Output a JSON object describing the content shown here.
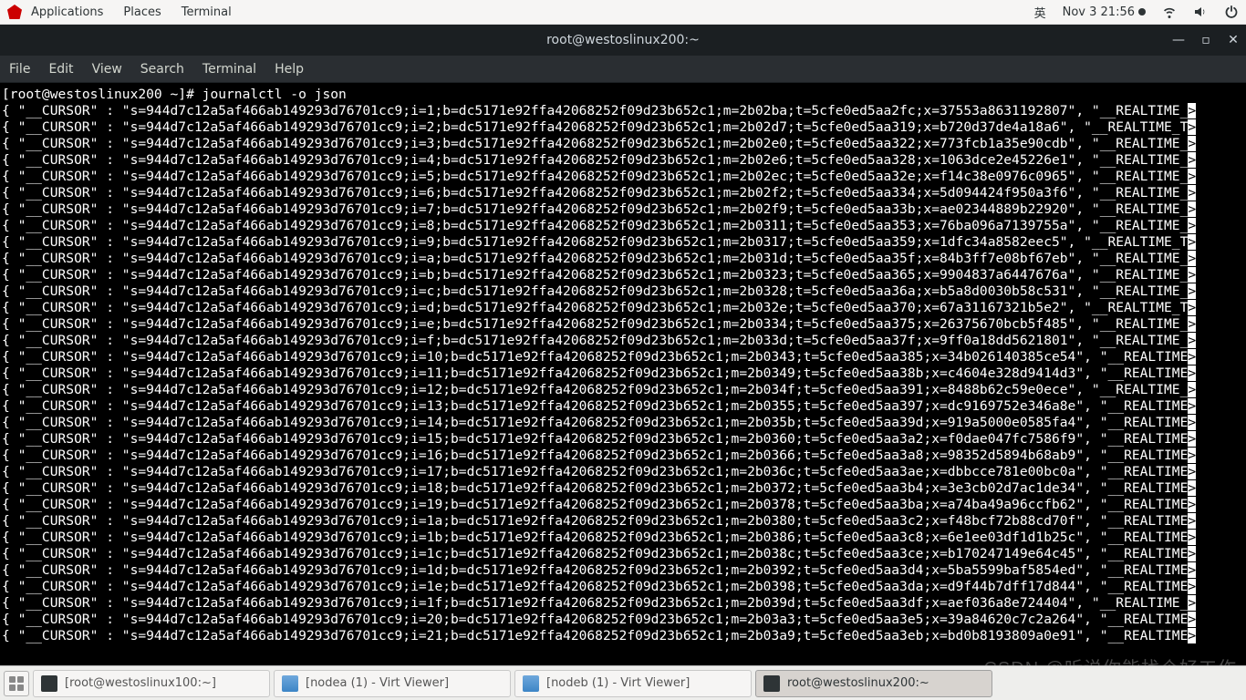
{
  "topbar": {
    "menus": [
      "Applications",
      "Places",
      "Terminal"
    ],
    "ime": "英",
    "clock": "Nov 3  21:56"
  },
  "terminal": {
    "title": "root@westoslinux200:~",
    "menus": [
      "File",
      "Edit",
      "View",
      "Search",
      "Terminal",
      "Help"
    ],
    "win_controls": {
      "min": "—",
      "max": "▫",
      "close": "✕"
    },
    "prompt": "[root@westoslinux200 ~]# ",
    "command": "journalctl -o json",
    "cursor_prefix": "{ \"__CURSOR\" : \"s=944d7c12a5af466ab149293d76701cc9;",
    "boot_id": ";b=dc5171e92ffa42068252f09d23b652c1;",
    "tail_key_a": "\", \"__REALTIME_T",
    "tail_key_b": "\", \"__REALTIME_TI",
    "tail_key_c": "\", \"__REALTIME_",
    "rows": [
      {
        "i": "i=1",
        "m": "m=2b02ba",
        "t": "t=5cfe0ed5aa2fc",
        "x": "x=37553a8631192807",
        "tail": "a"
      },
      {
        "i": "i=2",
        "m": "m=2b02d7",
        "t": "t=5cfe0ed5aa319",
        "x": "x=b720d37de4a18a6",
        "tail": "b"
      },
      {
        "i": "i=3",
        "m": "m=2b02e0",
        "t": "t=5cfe0ed5aa322",
        "x": "x=773fcb1a35e90cdb",
        "tail": "a"
      },
      {
        "i": "i=4",
        "m": "m=2b02e6",
        "t": "t=5cfe0ed5aa328",
        "x": "x=1063dce2e45226e1",
        "tail": "a"
      },
      {
        "i": "i=5",
        "m": "m=2b02ec",
        "t": "t=5cfe0ed5aa32e",
        "x": "x=f14c38e0976c0965",
        "tail": "a"
      },
      {
        "i": "i=6",
        "m": "m=2b02f2",
        "t": "t=5cfe0ed5aa334",
        "x": "x=5d094424f950a3f6",
        "tail": "a"
      },
      {
        "i": "i=7",
        "m": "m=2b02f9",
        "t": "t=5cfe0ed5aa33b",
        "x": "x=ae02344889b22920",
        "tail": "a"
      },
      {
        "i": "i=8",
        "m": "m=2b0311",
        "t": "t=5cfe0ed5aa353",
        "x": "x=76ba096a7139755a",
        "tail": "a"
      },
      {
        "i": "i=9",
        "m": "m=2b0317",
        "t": "t=5cfe0ed5aa359",
        "x": "x=1dfc34a8582eec5",
        "tail": "b"
      },
      {
        "i": "i=a",
        "m": "m=2b031d",
        "t": "t=5cfe0ed5aa35f",
        "x": "x=84b3ff7e08bf67eb",
        "tail": "a"
      },
      {
        "i": "i=b",
        "m": "m=2b0323",
        "t": "t=5cfe0ed5aa365",
        "x": "x=9904837a6447676a",
        "tail": "a"
      },
      {
        "i": "i=c",
        "m": "m=2b0328",
        "t": "t=5cfe0ed5aa36a",
        "x": "x=b5a8d0030b58c531",
        "tail": "a"
      },
      {
        "i": "i=d",
        "m": "m=2b032e",
        "t": "t=5cfe0ed5aa370",
        "x": "x=67a31167321b5e2",
        "tail": "b"
      },
      {
        "i": "i=e",
        "m": "m=2b0334",
        "t": "t=5cfe0ed5aa375",
        "x": "x=26375670bcb5f485",
        "tail": "a"
      },
      {
        "i": "i=f",
        "m": "m=2b033d",
        "t": "t=5cfe0ed5aa37f",
        "x": "x=9ff0a18dd5621801",
        "tail": "a"
      },
      {
        "i": "i=10",
        "m": "m=2b0343",
        "t": "t=5cfe0ed5aa385",
        "x": "x=34b026140385ce54",
        "tail": "c"
      },
      {
        "i": "i=11",
        "m": "m=2b0349",
        "t": "t=5cfe0ed5aa38b",
        "x": "x=c4604e328d9414d3",
        "tail": "c"
      },
      {
        "i": "i=12",
        "m": "m=2b034f",
        "t": "t=5cfe0ed5aa391",
        "x": "x=8488b62c59e0ece",
        "tail": "a"
      },
      {
        "i": "i=13",
        "m": "m=2b0355",
        "t": "t=5cfe0ed5aa397",
        "x": "x=dc9169752e346a8e",
        "tail": "c"
      },
      {
        "i": "i=14",
        "m": "m=2b035b",
        "t": "t=5cfe0ed5aa39d",
        "x": "x=919a5000e0585fa4",
        "tail": "c"
      },
      {
        "i": "i=15",
        "m": "m=2b0360",
        "t": "t=5cfe0ed5aa3a2",
        "x": "x=f0dae047fc7586f9",
        "tail": "c"
      },
      {
        "i": "i=16",
        "m": "m=2b0366",
        "t": "t=5cfe0ed5aa3a8",
        "x": "x=98352d5894b68ab9",
        "tail": "c"
      },
      {
        "i": "i=17",
        "m": "m=2b036c",
        "t": "t=5cfe0ed5aa3ae",
        "x": "x=dbbcce781e00bc0a",
        "tail": "c"
      },
      {
        "i": "i=18",
        "m": "m=2b0372",
        "t": "t=5cfe0ed5aa3b4",
        "x": "x=3e3cb02d7ac1de34",
        "tail": "c"
      },
      {
        "i": "i=19",
        "m": "m=2b0378",
        "t": "t=5cfe0ed5aa3ba",
        "x": "x=a74ba49a96ccfb62",
        "tail": "c"
      },
      {
        "i": "i=1a",
        "m": "m=2b0380",
        "t": "t=5cfe0ed5aa3c2",
        "x": "x=f48bcf72b88cd70f",
        "tail": "c"
      },
      {
        "i": "i=1b",
        "m": "m=2b0386",
        "t": "t=5cfe0ed5aa3c8",
        "x": "x=6e1ee03df1d1b25c",
        "tail": "c"
      },
      {
        "i": "i=1c",
        "m": "m=2b038c",
        "t": "t=5cfe0ed5aa3ce",
        "x": "x=b170247149e64c45",
        "tail": "c"
      },
      {
        "i": "i=1d",
        "m": "m=2b0392",
        "t": "t=5cfe0ed5aa3d4",
        "x": "x=5ba5599baf5854ed",
        "tail": "c"
      },
      {
        "i": "i=1e",
        "m": "m=2b0398",
        "t": "t=5cfe0ed5aa3da",
        "x": "x=d9f44b7dff17d844",
        "tail": "c"
      },
      {
        "i": "i=1f",
        "m": "m=2b039d",
        "t": "t=5cfe0ed5aa3df",
        "x": "x=aef036a8e724404",
        "tail": "a"
      },
      {
        "i": "i=20",
        "m": "m=2b03a3",
        "t": "t=5cfe0ed5aa3e5",
        "x": "x=39a84620c7c2a264",
        "tail": "c"
      },
      {
        "i": "i=21",
        "m": "m=2b03a9",
        "t": "t=5cfe0ed5aa3eb",
        "x": "x=bd0b8193809a0e91",
        "tail": "c"
      }
    ]
  },
  "taskbar": {
    "tasks": [
      {
        "label": "[root@westoslinux100:~]",
        "icon": "term",
        "active": false
      },
      {
        "label": "[nodea (1) - Virt Viewer]",
        "icon": "vm",
        "active": false
      },
      {
        "label": "[nodeb (1) - Virt Viewer]",
        "icon": "vm",
        "active": false
      },
      {
        "label": "root@westoslinux200:~",
        "icon": "term",
        "active": true
      }
    ]
  },
  "watermark": "CSDN @听说你能找个好工作"
}
